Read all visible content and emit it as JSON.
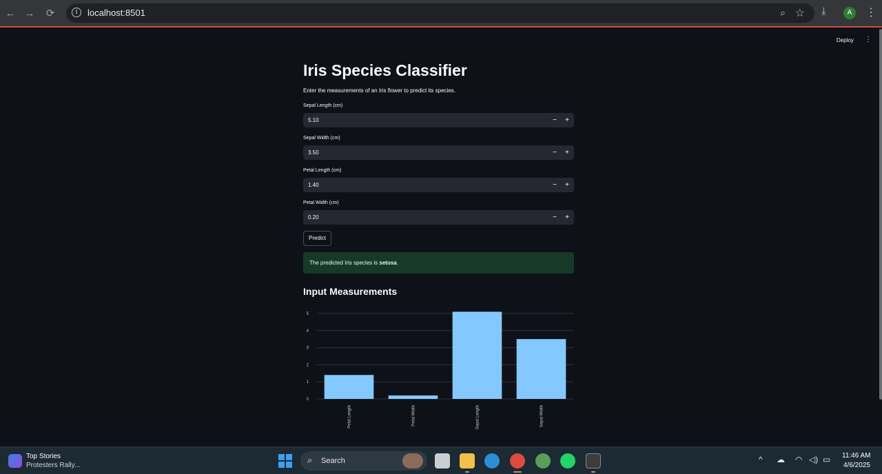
{
  "browser": {
    "url": "localhost:8501",
    "profile_initial": "A"
  },
  "app_header": {
    "deploy_label": "Deploy"
  },
  "page": {
    "title": "Iris Species Classifier",
    "subtitle": "Enter the measurements of an Iris flower to predict its species."
  },
  "inputs": [
    {
      "label": "Sepal Length (cm)",
      "value": "5.10"
    },
    {
      "label": "Sepal Width (cm)",
      "value": "3.50"
    },
    {
      "label": "Petal Length (cm)",
      "value": "1.40"
    },
    {
      "label": "Petal Width (cm)",
      "value": "0.20"
    }
  ],
  "stepper": {
    "minus": "−",
    "plus": "+"
  },
  "predict_button": "Predict",
  "result": {
    "prefix": "The predicted Iris species is ",
    "species": "setosa",
    "suffix": "."
  },
  "section_title": "Input Measurements",
  "chart_data": {
    "type": "bar",
    "categories": [
      "Petal Length",
      "Petal Width",
      "Sepal Length",
      "Sepal Width"
    ],
    "values": [
      1.4,
      0.2,
      5.1,
      3.5
    ],
    "title": "",
    "xlabel": "",
    "ylabel": "",
    "ylim": [
      0,
      5.2
    ],
    "yticks": [
      0,
      1,
      2,
      3,
      4,
      5
    ],
    "bar_color": "#83c9ff",
    "grid": true
  },
  "taskbar": {
    "news_title": "Top Stories",
    "news_subtitle": "Protesters Rally...",
    "search_label": "Search",
    "time": "11:46 AM",
    "date": "4/6/2025"
  },
  "colors": {
    "background": "#0e1117",
    "input_bg": "#262730",
    "success_bg": "#173928",
    "bar": "#83c9ff"
  }
}
